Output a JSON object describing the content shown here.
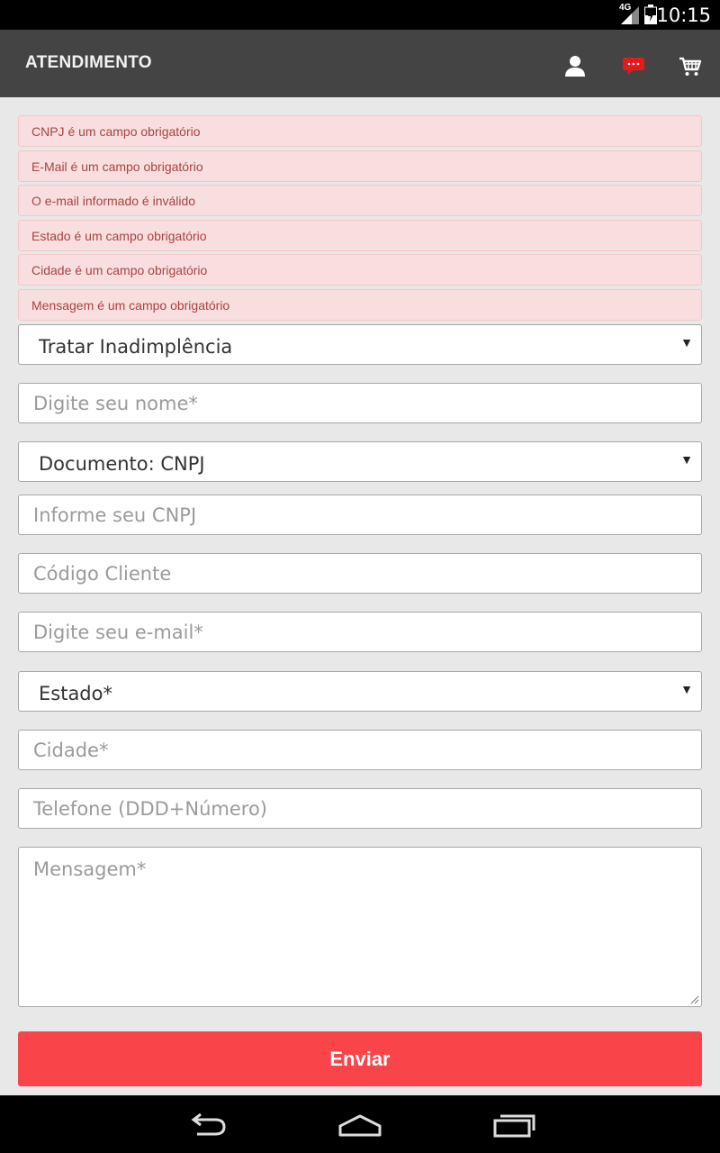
{
  "status_bar": {
    "time": "10:15",
    "network": "4G"
  },
  "app_bar": {
    "title": "ATENDIMENTO",
    "icons": [
      "user-icon",
      "chat-icon",
      "cart-icon"
    ],
    "chat_icon_color": "#e31b1b"
  },
  "errors": [
    "CNPJ é um campo obrigatório",
    "E-Mail é um campo obrigatório",
    "O e-mail informado é inválido",
    "Estado é um campo obrigatório",
    "Cidade é um campo obrigatório",
    "Mensagem é um campo obrigatório"
  ],
  "form": {
    "subject_select": "Tratar Inadimplência",
    "name_placeholder": "Digite seu nome*",
    "document_select": "Documento: CNPJ",
    "cnpj_placeholder": "Informe seu CNPJ",
    "client_code_placeholder": "Código Cliente",
    "email_placeholder": "Digite seu e-mail*",
    "state_select": "Estado*",
    "city_placeholder": "Cidade*",
    "phone_placeholder": "Telefone (DDD+Número)",
    "message_placeholder": "Mensagem*",
    "submit_label": "Enviar"
  },
  "colors": {
    "app_bar": "#444444",
    "error_bg": "#f8dede",
    "error_text": "#a94442",
    "submit_bg": "#f9444a"
  },
  "nav_bar": {
    "icons": [
      "back-icon",
      "home-icon",
      "recents-icon"
    ]
  }
}
